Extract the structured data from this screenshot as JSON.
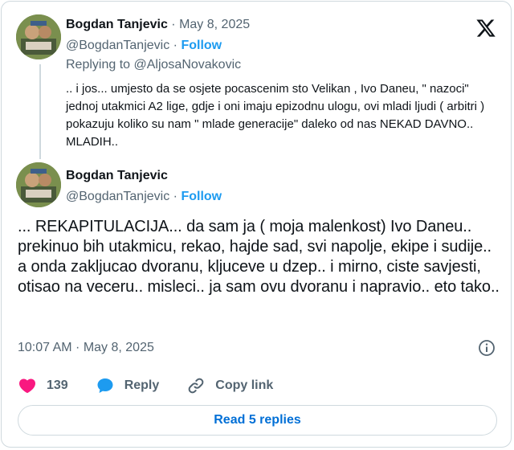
{
  "parent_tweet": {
    "author_name": "Bogdan Tanjevic",
    "separator": "·",
    "date": "May 8, 2025",
    "handle": "@BogdanTanjevic",
    "follow_label": "Follow",
    "replying_prefix": "Replying to",
    "replying_to": "@AljosaNovakovic",
    "text": ".. i jos... umjesto da se osjete pocascenim sto Velikan , Ivo Daneu, \" nazoci\" jednoj utakmici A2 lige, gdje i oni imaju epizodnu ulogu, ovi mladi ljudi ( arbitri ) pokazuju koliko su nam \" mlade generacije\" daleko od nas NEKAD DAVNO.. MLADIH.."
  },
  "main_tweet": {
    "author_name": "Bogdan Tanjevic",
    "handle": "@BogdanTanjevic",
    "separator": "·",
    "follow_label": "Follow",
    "text": "... REKAPITULACIJA... da sam ja ( moja malenkost) Ivo Daneu.. prekinuo bih utakmicu, rekao, hajde sad, svi napolje, ekipe i sudije.. a onda zakljucao dvoranu, kljuceve u dzep.. i mirno, ciste savjesti, otisao na veceru.. misleci.. ja sam ovu dvoranu i napravio.. eto tako..",
    "timestamp": "10:07 AM · May 8, 2025"
  },
  "actions": {
    "like_count": "139",
    "reply_label": "Reply",
    "copy_link_label": "Copy link"
  },
  "read_replies_label": "Read 5 replies",
  "icons": {
    "logo": "x-logo-icon",
    "like": "heart-icon",
    "reply": "speech-bubble-icon",
    "copy": "link-icon",
    "info": "info-icon"
  },
  "colors": {
    "like": "#f91880",
    "reply": "#1d9bf0",
    "follow": "#1d9bf0",
    "muted": "#536471",
    "read_replies": "#006fd6"
  }
}
